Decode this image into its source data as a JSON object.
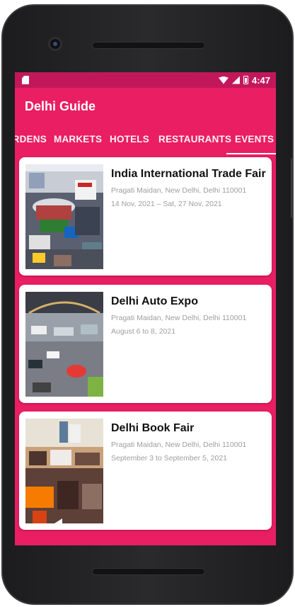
{
  "status_bar": {
    "time": "4:47"
  },
  "app_bar": {
    "title": "Delhi Guide"
  },
  "tabs": [
    {
      "label": "GARDENS",
      "active": false
    },
    {
      "label": "MARKETS",
      "active": false
    },
    {
      "label": "HOTELS",
      "active": false
    },
    {
      "label": "RESTAURANTS",
      "active": false
    },
    {
      "label": "EVENTS",
      "active": true
    }
  ],
  "events": [
    {
      "title": "India International Trade Fair",
      "address": "Pragati Maidan, New Delhi, Delhi 110001",
      "date": "14 Nov, 2021 – Sat, 27 Nov, 2021"
    },
    {
      "title": "Delhi Auto Expo",
      "address": "Pragati Maidan, New Delhi, Delhi 110001",
      "date": "August 6 to 8, 2021"
    },
    {
      "title": "Delhi Book Fair",
      "address": "Pragati Maidan, New Delhi, Delhi 110001",
      "date": "September 3 to September 5, 2021"
    }
  ],
  "colors": {
    "primary": "#e91e63",
    "primary_dark": "#c2185b"
  },
  "nav": {
    "back_icon": "back-icon",
    "home_icon": "home-icon",
    "recents_icon": "recents-icon"
  }
}
